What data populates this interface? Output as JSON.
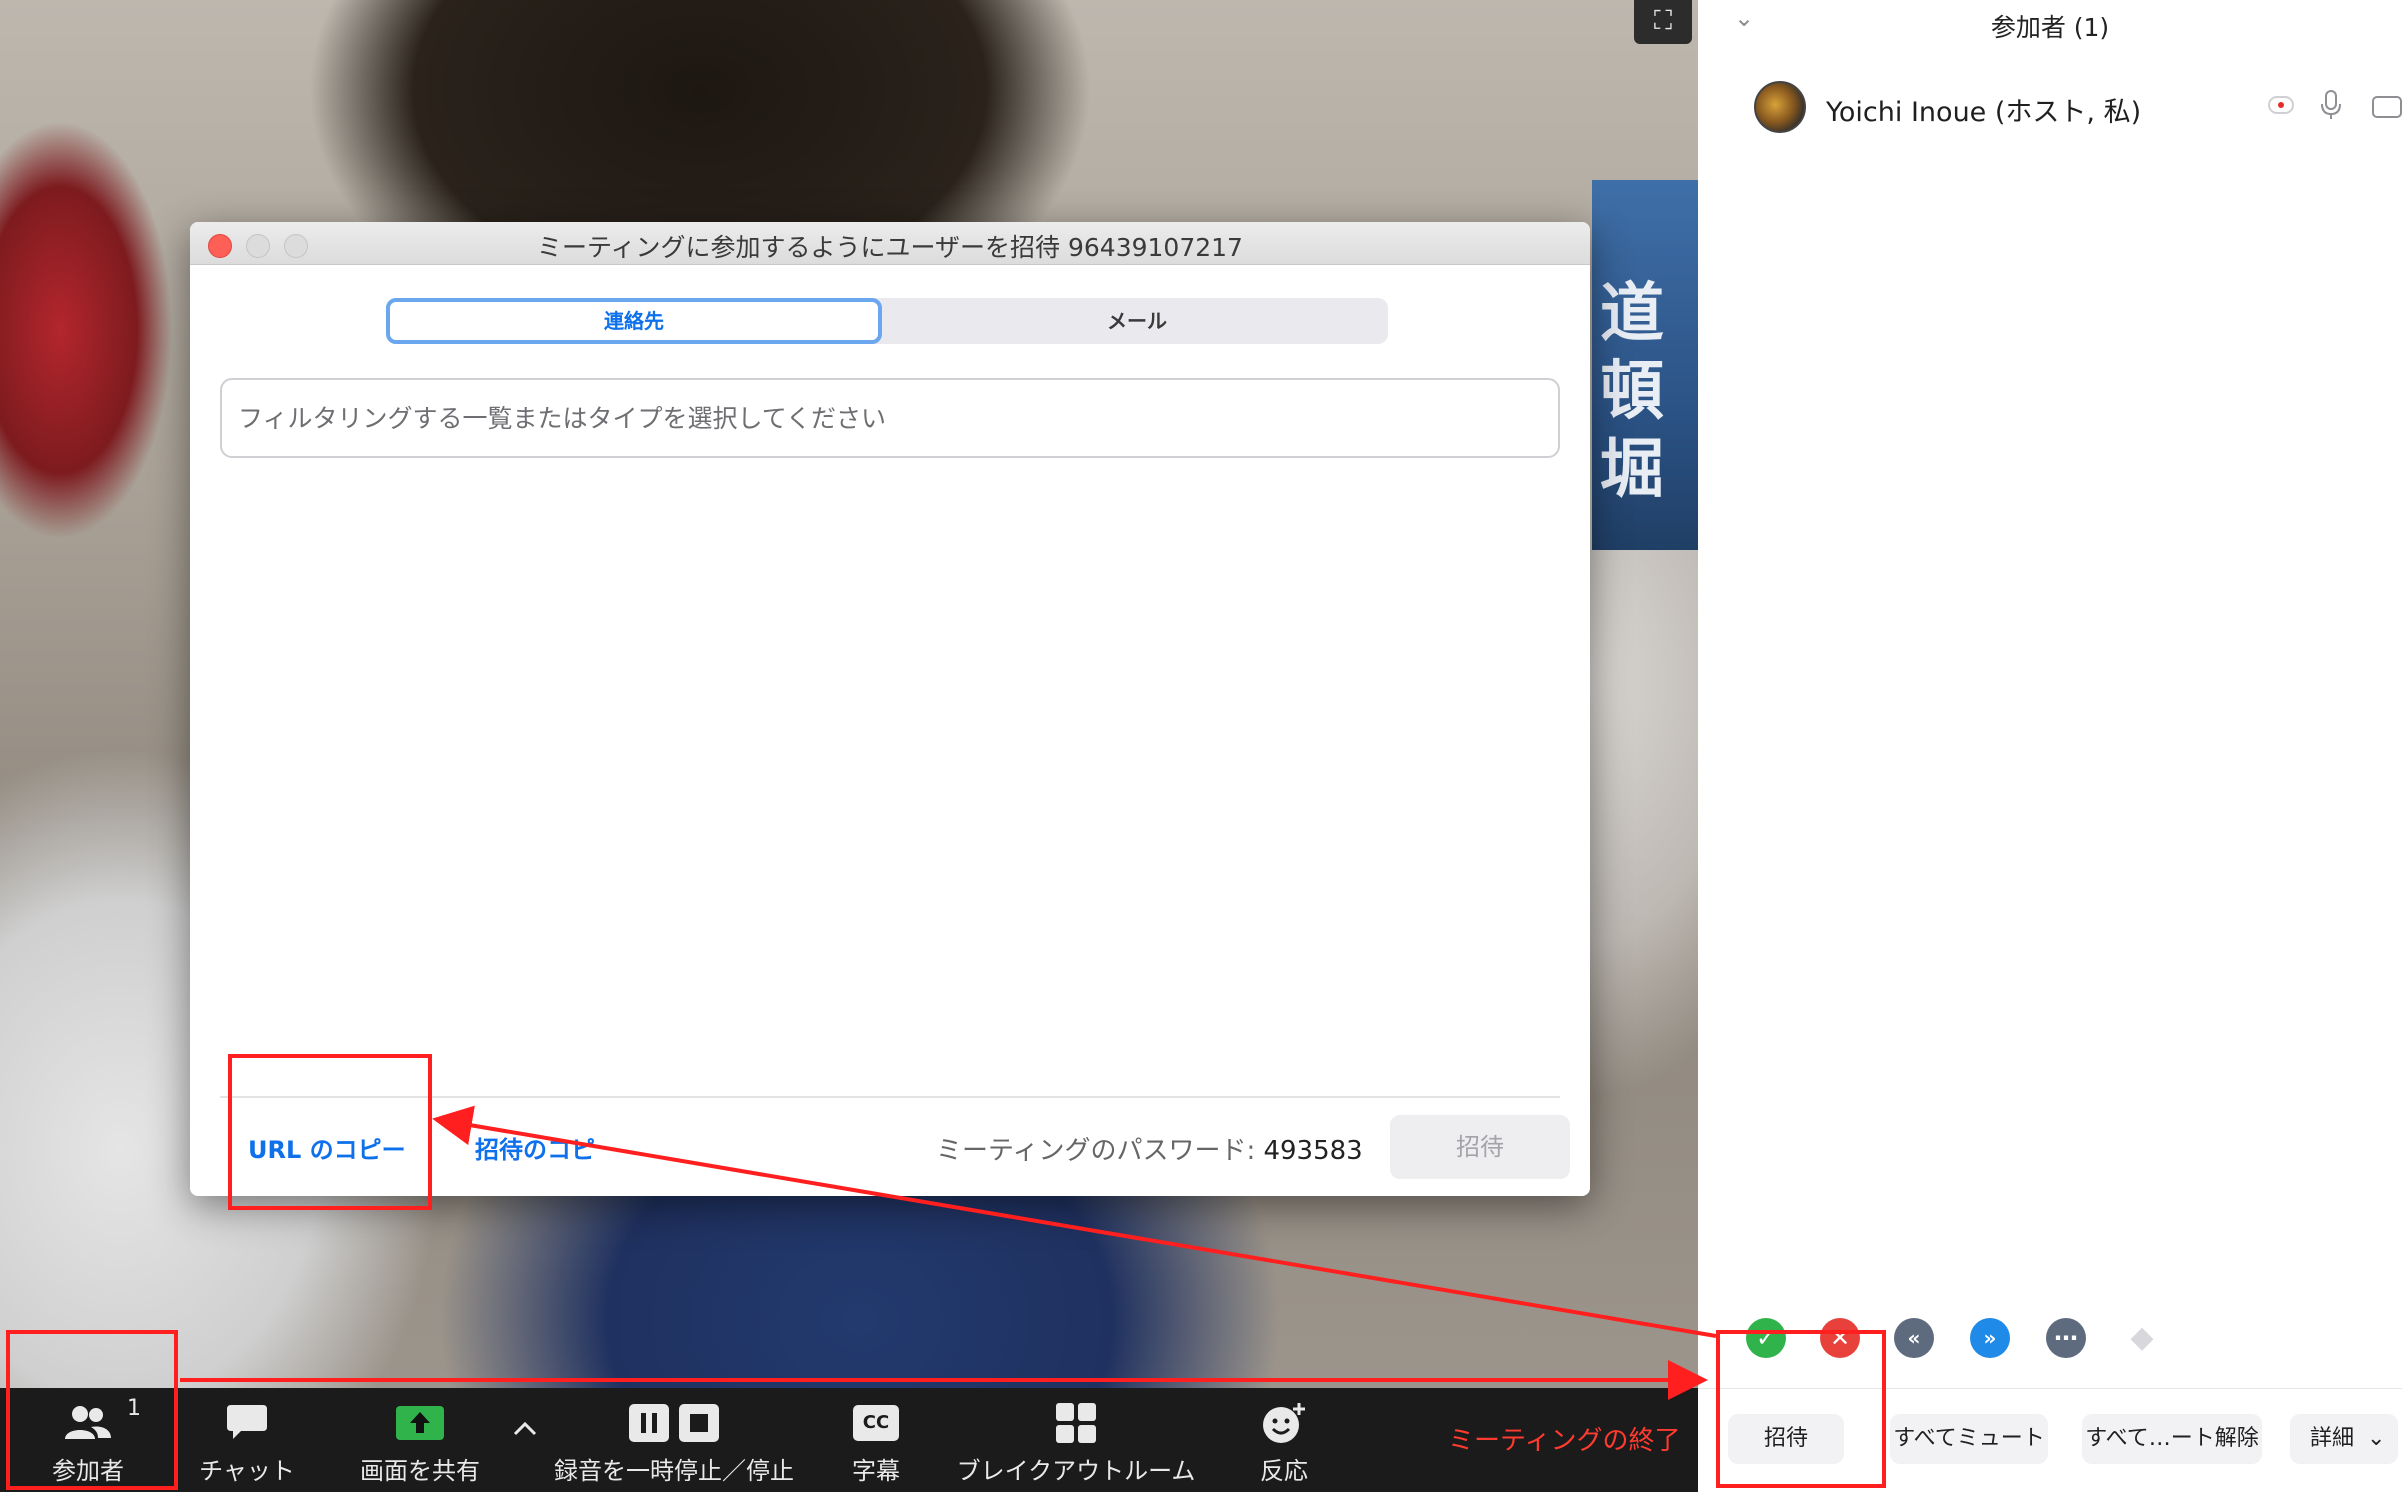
{
  "video": {
    "poster_text": "道頓堀"
  },
  "dialog": {
    "title": "ミーティングに参加するようにユーザーを招待 96439107217",
    "tabs": {
      "contacts": "連絡先",
      "mail": "メール"
    },
    "filter_placeholder": "フィルタリングする一覧またはタイプを選択してください",
    "copy_url": "URL のコピー",
    "copy_invite": "招待のコピー",
    "password_label": "ミーティングのパスワード:",
    "password_value": "493583",
    "invite_button": "招待"
  },
  "panel": {
    "title": "参加者 (1)",
    "participant_name": "Yoichi Inoue (ホスト, 私)",
    "buttons": {
      "invite": "招待",
      "mute_all": "すべてミュート",
      "unmute_all": "すべて…ート解除",
      "more": "詳細"
    }
  },
  "toolbar": {
    "participants_count": "1",
    "participants": "参加者",
    "chat": "チャット",
    "share": "画面を共有",
    "record": "録音を一時停止／停止",
    "cc": "字幕",
    "breakout": "ブレイクアウトルーム",
    "reactions": "反応",
    "end_meeting": "ミーティングの終了",
    "cc_icon_text": "CC"
  },
  "colors": {
    "accent_blue": "#0e71eb",
    "annotation_red": "#ff1f1f",
    "end_red": "#ff3b30",
    "share_green": "#2fb34a"
  }
}
